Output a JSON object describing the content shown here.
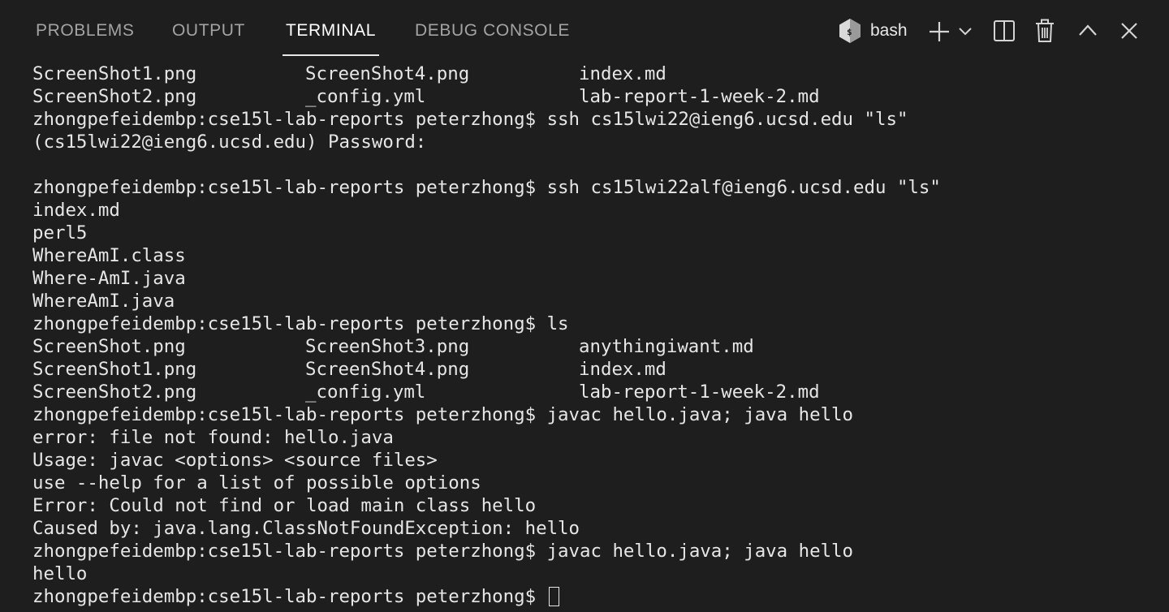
{
  "tabs": [
    {
      "label": "PROBLEMS",
      "active": false
    },
    {
      "label": "OUTPUT",
      "active": false
    },
    {
      "label": "TERMINAL",
      "active": true
    },
    {
      "label": "DEBUG CONSOLE",
      "active": false
    }
  ],
  "terminal_selector": {
    "name": "bash",
    "icon": "bash-shell-icon"
  },
  "actions": {
    "new_terminal_icon": "plus-icon",
    "dropdown_icon": "chevron-down-icon",
    "split_icon": "split-terminal-icon",
    "kill_icon": "trash-icon",
    "maximize_icon": "chevron-up-icon",
    "close_icon": "close-icon"
  },
  "colors": {
    "background": "#1e1e1e",
    "text": "#e6e6e6",
    "inactive_tab": "#a3a3a3",
    "active_tab": "#ffffff"
  },
  "terminal": {
    "listing_a": [
      [
        "ScreenShot1.png",
        "ScreenShot4.png",
        "index.md"
      ],
      [
        "ScreenShot2.png",
        "_config.yml",
        "lab-report-1-week-2.md"
      ]
    ],
    "l3": "zhongpefeidembp:cse15l-lab-reports peterzhong$ ssh cs15lwi22@ieng6.ucsd.edu \"ls\"",
    "l4": "(cs15lwi22@ieng6.ucsd.edu) Password:",
    "l5": "",
    "l6": "zhongpefeidembp:cse15l-lab-reports peterzhong$ ssh cs15lwi22alf@ieng6.ucsd.edu \"ls\"",
    "l7": "index.md",
    "l8": "perl5",
    "l9": "WhereAmI.class",
    "l10": "Where-AmI.java",
    "l11": "WhereAmI.java",
    "l12": "zhongpefeidembp:cse15l-lab-reports peterzhong$ ls",
    "listing_b": [
      [
        "ScreenShot.png",
        "ScreenShot3.png",
        "anythingiwant.md"
      ],
      [
        "ScreenShot1.png",
        "ScreenShot4.png",
        "index.md"
      ],
      [
        "ScreenShot2.png",
        "_config.yml",
        "lab-report-1-week-2.md"
      ]
    ],
    "l16": "zhongpefeidembp:cse15l-lab-reports peterzhong$ javac hello.java; java hello",
    "l17": "error: file not found: hello.java",
    "l18": "Usage: javac <options> <source files>",
    "l19": "use --help for a list of possible options",
    "l20": "Error: Could not find or load main class hello",
    "l21": "Caused by: java.lang.ClassNotFoundException: hello",
    "l22": "zhongpefeidembp:cse15l-lab-reports peterzhong$ javac hello.java; java hello",
    "l23": "hello",
    "prompt": "zhongpefeidembp:cse15l-lab-reports peterzhong$ "
  }
}
